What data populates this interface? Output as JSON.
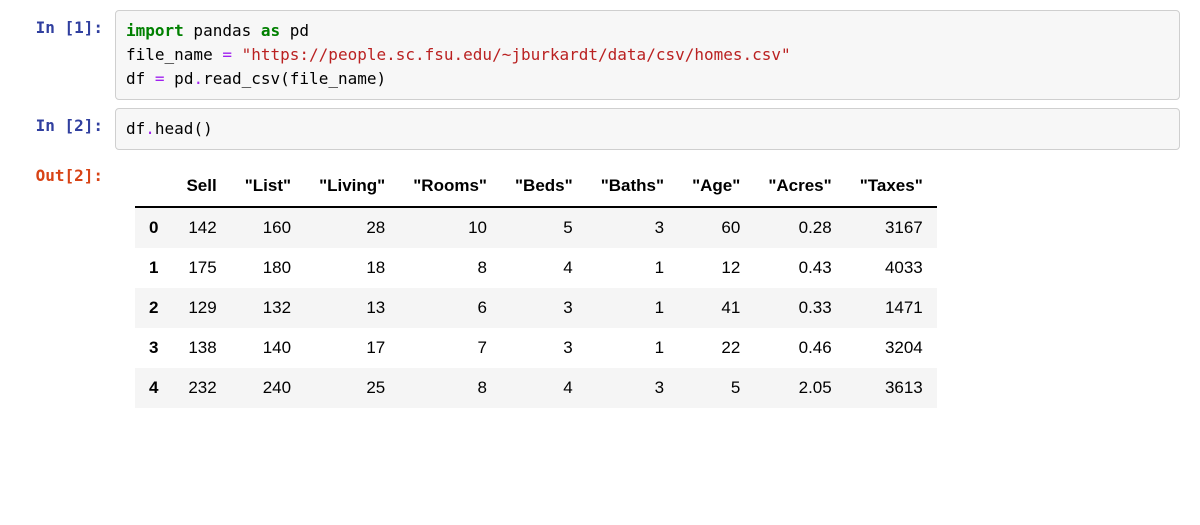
{
  "cells": {
    "in1": {
      "prompt": "In [1]:",
      "tok_import": "import",
      "tok_pandas": " pandas ",
      "tok_as": "as",
      "tok_pd": " pd",
      "line2_a": "file_name ",
      "line2_eq": "=",
      "line2_b": " ",
      "line2_str": "\"https://people.sc.fsu.edu/~jburkardt/data/csv/homes.csv\"",
      "line3_a": "df ",
      "line3_eq": "=",
      "line3_b": " pd",
      "line3_dot": ".",
      "line3_c": "read_csv(file_name)"
    },
    "in2": {
      "prompt": "In [2]:",
      "line1_a": "df",
      "line1_dot": ".",
      "line1_b": "head()"
    },
    "out2": {
      "prompt": "Out[2]:"
    }
  },
  "chart_data": {
    "type": "table",
    "columns": [
      "Sell",
      "\"List\"",
      "\"Living\"",
      "\"Rooms\"",
      "\"Beds\"",
      "\"Baths\"",
      "\"Age\"",
      "\"Acres\"",
      "\"Taxes\""
    ],
    "index": [
      "0",
      "1",
      "2",
      "3",
      "4"
    ],
    "rows": [
      [
        "142",
        "160",
        "28",
        "10",
        "5",
        "3",
        "60",
        "0.28",
        "3167"
      ],
      [
        "175",
        "180",
        "18",
        "8",
        "4",
        "1",
        "12",
        "0.43",
        "4033"
      ],
      [
        "129",
        "132",
        "13",
        "6",
        "3",
        "1",
        "41",
        "0.33",
        "1471"
      ],
      [
        "138",
        "140",
        "17",
        "7",
        "3",
        "1",
        "22",
        "0.46",
        "3204"
      ],
      [
        "232",
        "240",
        "25",
        "8",
        "4",
        "3",
        "5",
        "2.05",
        "3613"
      ]
    ]
  }
}
